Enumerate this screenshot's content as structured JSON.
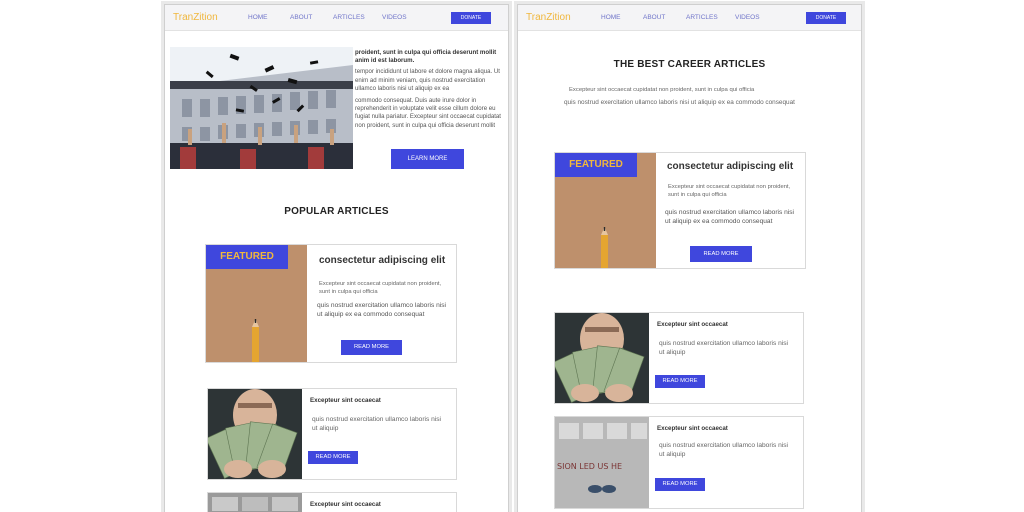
{
  "brand": "TranZition",
  "nav": {
    "home": "HOME",
    "about": "ABOUT",
    "articles": "ARTICLES",
    "videos": "VIDEOS",
    "donate": "DONATE"
  },
  "left": {
    "hero_bold": "proident, sunt in culpa qui officia deserunt mollit anim id est laborum.",
    "hero_p1": "tempor incididunt ut labore et dolore magna aliqua. Ut enim ad minim veniam, quis nostrud exercitation ullamco laboris nisi ut aliquip ex ea",
    "hero_p2": "commodo consequat. Duis aute irure dolor in reprehenderit in voluptate velit esse cillum dolore eu fugiat nulla pariatur. Excepteur sint occaecat cupidatat non proident, sunt in culpa qui officia deserunt mollit",
    "learn_more": "LEARN MORE",
    "section_title": "POPULAR ARTICLES",
    "featured": {
      "tag": "FEATURED",
      "heading": "consectetur adipiscing elit",
      "small": "Excepteur sint occaecat cupidatat non proident, sunt in culpa qui officia",
      "text": "quis nostrud exercitation ullamco laboris nisi ut aliquip ex ea commodo consequat",
      "button": "READ MORE"
    },
    "card1": {
      "heading": "Excepteur sint occaecat",
      "text": "quis nostrud exercitation ullamco laboris nisi ut aliquip",
      "button": "READ MORE"
    },
    "card2": {
      "heading": "Excepteur sint occaecat"
    }
  },
  "right": {
    "section_title": "THE BEST CAREER ARTICLES",
    "intro_small": "Excepteur sint occaecat cupidatat non proident, sunt in culpa qui officia",
    "intro_text": "quis nostrud exercitation ullamco laboris nisi ut aliquip ex ea commodo consequat",
    "featured": {
      "tag": "FEATURED",
      "heading": "consectetur adipiscing elit",
      "small": "Excepteur sint occaecat cupidatat non proident, sunt in culpa qui officia",
      "text": "quis nostrud exercitation ullamco laboris nisi ut aliquip ex ea commodo consequat",
      "button": "READ MORE"
    },
    "card1": {
      "heading": "Excepteur sint occaecat",
      "text": "quis nostrud exercitation ullamco laboris nisi ut aliquip",
      "button": "READ MORE"
    },
    "card2": {
      "heading": "Excepteur sint occaecat",
      "text": "quis nostrud exercitation ullamco laboris nisi ut aliquip",
      "button": "READ MORE",
      "sign_text": "SION LED US HE"
    }
  },
  "colors": {
    "accent": "#3f47dd",
    "brand": "#f0b73d",
    "text": "#555555",
    "border": "#d9d9d9"
  }
}
